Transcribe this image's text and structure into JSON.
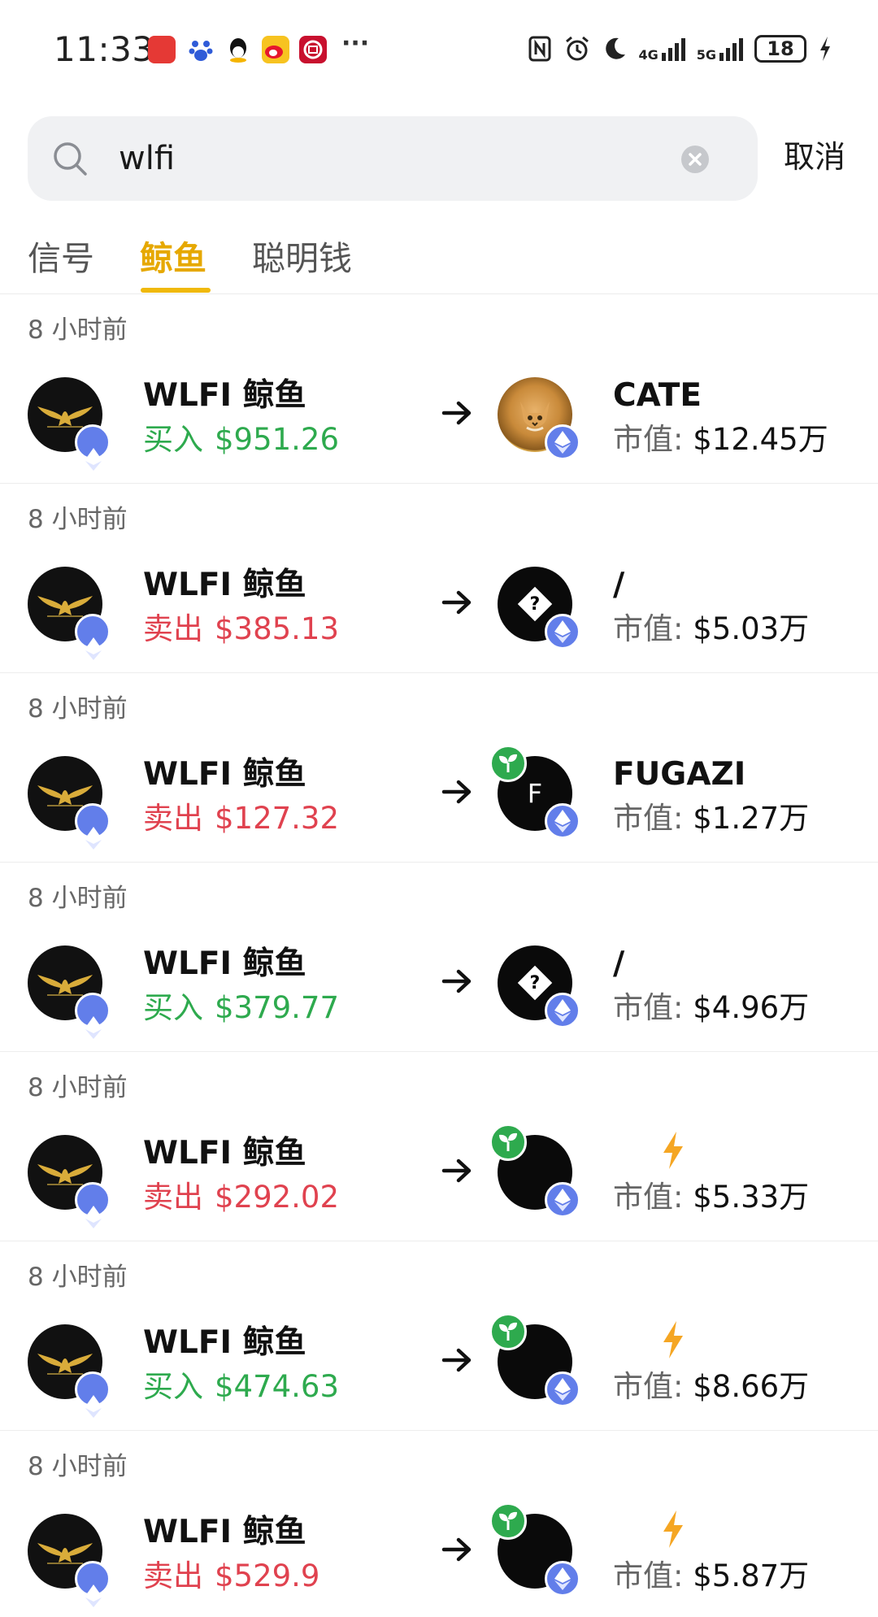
{
  "status_bar": {
    "time": "11:33",
    "network_1": "4G",
    "network_2": "5G",
    "battery": "18"
  },
  "search": {
    "query": "wlfi",
    "cancel_label": "取消"
  },
  "tabs": [
    {
      "label": "信号",
      "active": false
    },
    {
      "label": "鲸鱼",
      "active": true
    },
    {
      "label": "聪明钱",
      "active": false
    }
  ],
  "colors": {
    "accent": "#f0b90b",
    "buy": "#2eaa4e",
    "sell": "#e0424f",
    "eth_badge": "#627eea"
  },
  "market_cap_label": "市值:",
  "rows": [
    {
      "time": "8 小时前",
      "whale": "WLFI 鲸鱼",
      "action": "买入",
      "side": "buy",
      "amount": "$951.26",
      "token_name": "CATE",
      "token_icon": "cat-token-icon",
      "market_cap": "$12.45万"
    },
    {
      "time": "8 小时前",
      "whale": "WLFI 鲸鱼",
      "action": "卖出",
      "side": "sell",
      "amount": "$385.13",
      "token_name": "/",
      "token_icon": "unknown-token-icon",
      "market_cap": "$5.03万"
    },
    {
      "time": "8 小时前",
      "whale": "WLFI 鲸鱼",
      "action": "卖出",
      "side": "sell",
      "amount": "$127.32",
      "token_name": "FUGAZI",
      "token_icon": "letter-f-token-icon",
      "market_cap": "$1.27万"
    },
    {
      "time": "8 小时前",
      "whale": "WLFI 鲸鱼",
      "action": "买入",
      "side": "buy",
      "amount": "$379.77",
      "token_name": "/",
      "token_icon": "unknown-token-icon",
      "market_cap": "$4.96万"
    },
    {
      "time": "8 小时前",
      "whale": "WLFI 鲸鱼",
      "action": "卖出",
      "side": "sell",
      "amount": "$292.02",
      "token_name": "",
      "token_icon": "new-token-icon",
      "market_cap": "$5.33万"
    },
    {
      "time": "8 小时前",
      "whale": "WLFI 鲸鱼",
      "action": "买入",
      "side": "buy",
      "amount": "$474.63",
      "token_name": "",
      "token_icon": "new-token-icon",
      "market_cap": "$8.66万"
    },
    {
      "time": "8 小时前",
      "whale": "WLFI 鲸鱼",
      "action": "卖出",
      "side": "sell",
      "amount": "$529.9",
      "token_name": "",
      "token_icon": "new-token-icon",
      "market_cap": "$5.87万"
    }
  ]
}
